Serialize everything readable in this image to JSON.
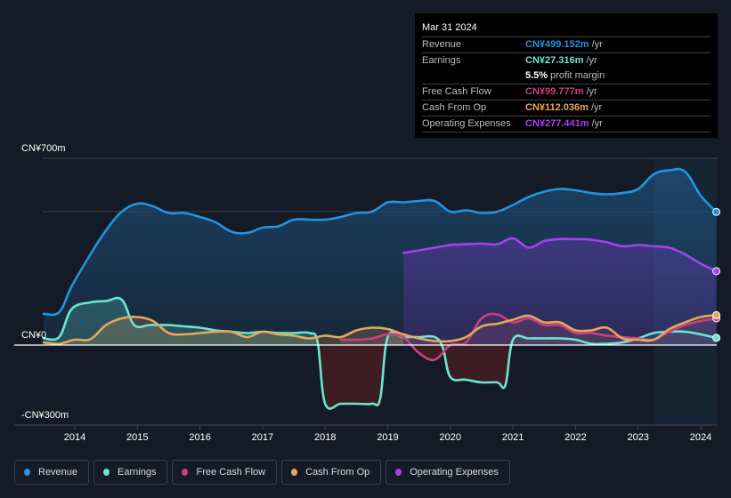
{
  "tooltip": {
    "date": "Mar 31 2024",
    "rows": [
      {
        "label": "Revenue",
        "value": "CN¥499.152m",
        "unit": "/yr",
        "color": "#2394df"
      },
      {
        "label": "Earnings",
        "value": "CN¥27.316m",
        "unit": "/yr",
        "color": "#6ce5d0"
      },
      {
        "label": "",
        "value": "5.5%",
        "unit": "profit margin",
        "color": "#ffffff"
      },
      {
        "label": "Free Cash Flow",
        "value": "CN¥99.777m",
        "unit": "/yr",
        "color": "#c8417f"
      },
      {
        "label": "Cash From Op",
        "value": "CN¥112.036m",
        "unit": "/yr",
        "color": "#e8a85a"
      },
      {
        "label": "Operating Expenses",
        "value": "CN¥277.441m",
        "unit": "/yr",
        "color": "#a542ed"
      }
    ]
  },
  "legend": [
    {
      "label": "Revenue",
      "color": "#2394df"
    },
    {
      "label": "Earnings",
      "color": "#6ce5d0"
    },
    {
      "label": "Free Cash Flow",
      "color": "#c8417f"
    },
    {
      "label": "Cash From Op",
      "color": "#e8a85a"
    },
    {
      "label": "Operating Expenses",
      "color": "#a542ed"
    }
  ],
  "chart_data": {
    "type": "area",
    "title": "",
    "xlabel": "",
    "ylabel": "",
    "currency_unit": "CN¥ millions",
    "ylim": [
      -300,
      700
    ],
    "xlim": [
      2013.5,
      2024.25
    ],
    "y_tick_labels": [
      {
        "value": 700,
        "label": "CN¥700m"
      },
      {
        "value": 0,
        "label": "CN¥0"
      },
      {
        "value": -300,
        "label": "-CN¥300m"
      }
    ],
    "x_tick_labels": [
      "2014",
      "2015",
      "2016",
      "2017",
      "2018",
      "2019",
      "2020",
      "2021",
      "2022",
      "2023",
      "2024"
    ],
    "x_tick_values": [
      2014,
      2015,
      2016,
      2017,
      2018,
      2019,
      2020,
      2021,
      2022,
      2023,
      2024
    ],
    "gridlines_y": [
      700,
      500,
      0
    ],
    "forecast_shade_start": 2023.25,
    "legend_position": "bottom-left",
    "series": [
      {
        "name": "Revenue",
        "color": "#2394df",
        "x": [
          2013.5,
          2013.75,
          2013.95,
          2014.25,
          2014.5,
          2014.75,
          2015.0,
          2015.25,
          2015.5,
          2015.75,
          2016.0,
          2016.25,
          2016.5,
          2016.75,
          2017.0,
          2017.25,
          2017.5,
          2017.75,
          2018.0,
          2018.25,
          2018.5,
          2018.75,
          2019.0,
          2019.25,
          2019.5,
          2019.75,
          2020.0,
          2020.25,
          2020.5,
          2020.75,
          2021.0,
          2021.25,
          2021.5,
          2021.75,
          2022.0,
          2022.25,
          2022.5,
          2022.75,
          2023.0,
          2023.25,
          2023.5,
          2023.75,
          2024.0,
          2024.25
        ],
        "values": [
          117,
          123,
          220,
          340,
          430,
          500,
          530,
          520,
          495,
          495,
          480,
          460,
          425,
          420,
          440,
          445,
          470,
          470,
          470,
          480,
          495,
          500,
          535,
          535,
          540,
          540,
          500,
          505,
          495,
          500,
          525,
          555,
          575,
          585,
          580,
          570,
          565,
          570,
          585,
          640,
          655,
          650,
          560,
          499
        ]
      },
      {
        "name": "Earnings",
        "color": "#6ce5d0",
        "x": [
          2013.5,
          2013.75,
          2013.95,
          2014.25,
          2014.5,
          2014.75,
          2014.95,
          2015.2,
          2015.5,
          2015.75,
          2016.0,
          2016.25,
          2016.5,
          2016.75,
          2017.0,
          2017.25,
          2017.5,
          2017.75,
          2017.88,
          2018.0,
          2018.25,
          2018.5,
          2018.75,
          2018.88,
          2019.0,
          2019.25,
          2019.5,
          2019.75,
          2019.88,
          2020.0,
          2020.25,
          2020.5,
          2020.75,
          2020.88,
          2021.0,
          2021.25,
          2021.5,
          2021.75,
          2022.0,
          2022.25,
          2022.5,
          2022.75,
          2023.0,
          2023.25,
          2023.5,
          2023.75,
          2024.0,
          2024.25
        ],
        "values": [
          25,
          30,
          135,
          160,
          165,
          170,
          75,
          75,
          75,
          70,
          65,
          55,
          50,
          45,
          50,
          45,
          45,
          45,
          10,
          -220,
          -220,
          -220,
          -220,
          -200,
          30,
          30,
          30,
          30,
          -10,
          -120,
          -130,
          -140,
          -140,
          -150,
          20,
          25,
          25,
          25,
          20,
          5,
          5,
          10,
          25,
          45,
          50,
          50,
          40,
          27
        ]
      },
      {
        "name": "Free Cash Flow",
        "color": "#c8417f",
        "x": [
          2018.25,
          2018.5,
          2018.75,
          2019.0,
          2019.25,
          2019.5,
          2019.75,
          2020.0,
          2020.25,
          2020.5,
          2020.75,
          2021.0,
          2021.25,
          2021.5,
          2021.75,
          2022.0,
          2022.25,
          2022.5,
          2022.75,
          2023.0,
          2023.25,
          2023.5,
          2023.75,
          2024.0,
          2024.25
        ],
        "values": [
          20,
          20,
          25,
          40,
          30,
          -30,
          -55,
          0,
          10,
          100,
          115,
          85,
          100,
          75,
          75,
          45,
          45,
          35,
          30,
          25,
          20,
          50,
          75,
          90,
          100
        ]
      },
      {
        "name": "Cash From Op",
        "color": "#e8a85a",
        "x": [
          2013.5,
          2013.75,
          2014.0,
          2014.25,
          2014.5,
          2014.75,
          2015.0,
          2015.25,
          2015.5,
          2015.75,
          2016.0,
          2016.25,
          2016.5,
          2016.75,
          2017.0,
          2017.25,
          2017.5,
          2017.75,
          2018.0,
          2018.25,
          2018.5,
          2018.75,
          2019.0,
          2019.25,
          2019.5,
          2019.75,
          2020.0,
          2020.25,
          2020.5,
          2020.75,
          2021.0,
          2021.25,
          2021.5,
          2021.75,
          2022.0,
          2022.25,
          2022.5,
          2022.75,
          2023.0,
          2023.25,
          2023.5,
          2023.75,
          2024.0,
          2024.25
        ],
        "values": [
          10,
          5,
          20,
          22,
          75,
          100,
          105,
          90,
          45,
          40,
          45,
          50,
          50,
          30,
          50,
          40,
          35,
          25,
          35,
          30,
          55,
          65,
          60,
          40,
          25,
          15,
          15,
          30,
          70,
          80,
          95,
          110,
          85,
          85,
          55,
          55,
          65,
          25,
          20,
          20,
          60,
          85,
          105,
          112
        ]
      },
      {
        "name": "Operating Expenses",
        "color": "#a542ed",
        "x": [
          2019.25,
          2019.5,
          2019.75,
          2020.0,
          2020.25,
          2020.5,
          2020.75,
          2021.0,
          2021.25,
          2021.5,
          2021.75,
          2022.0,
          2022.25,
          2022.5,
          2022.75,
          2023.0,
          2023.25,
          2023.5,
          2023.75,
          2024.0,
          2024.25
        ],
        "values": [
          345,
          355,
          365,
          375,
          378,
          380,
          378,
          400,
          365,
          390,
          397,
          397,
          395,
          385,
          370,
          375,
          370,
          365,
          340,
          305,
          277
        ]
      }
    ]
  }
}
